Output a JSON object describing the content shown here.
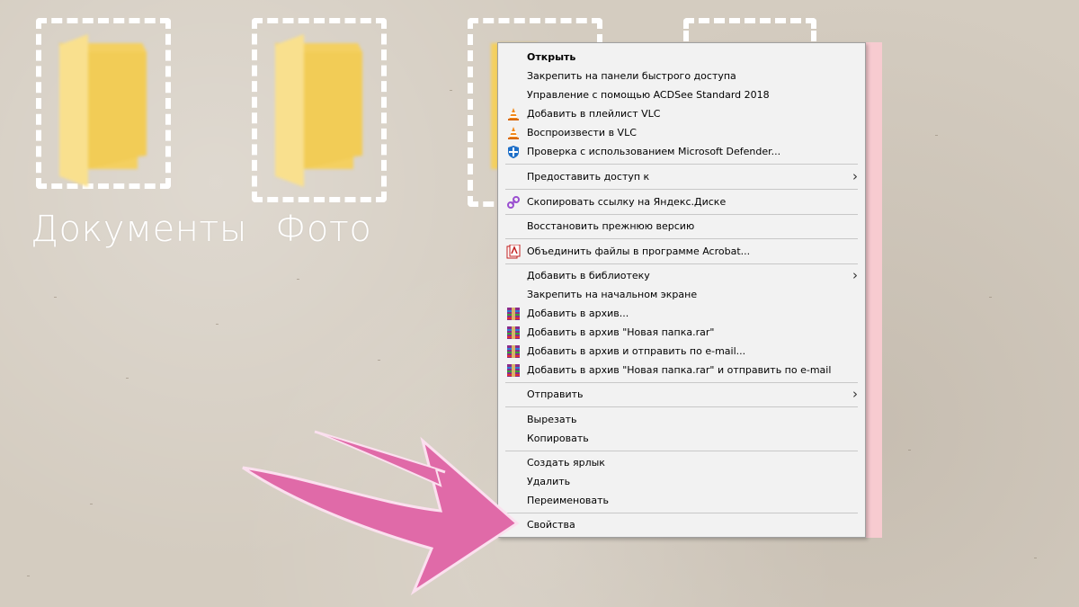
{
  "desktop": {
    "folders": [
      {
        "label": "Документы"
      },
      {
        "label": "Фото"
      }
    ]
  },
  "context_menu": {
    "items": [
      {
        "label": "Открыть",
        "bold": true,
        "icon": ""
      },
      {
        "label": "Закрепить на панели быстрого доступа",
        "icon": ""
      },
      {
        "label": "Управление с помощью ACDSee Standard 2018",
        "icon": ""
      },
      {
        "label": "Добавить в плейлист VLC",
        "icon": "vlc-icon"
      },
      {
        "label": "Воспроизвести в VLC",
        "icon": "vlc-icon"
      },
      {
        "label": "Проверка с использованием Microsoft Defender...",
        "icon": "defender-icon"
      },
      {
        "label": "Предоставить доступ к",
        "submenu": true
      },
      {
        "label": "Скопировать ссылку на Яндекс.Диске",
        "icon": "link-icon"
      },
      {
        "label": "Восстановить прежнюю версию"
      },
      {
        "label": "Объединить файлы в программе Acrobat...",
        "icon": "acrobat-icon"
      },
      {
        "label": "Добавить в библиотеку",
        "submenu": true
      },
      {
        "label": "Закрепить на начальном экране"
      },
      {
        "label": "Добавить в архив...",
        "icon": "winrar-icon"
      },
      {
        "label": "Добавить в архив \"Новая папка.rar\"",
        "icon": "winrar-icon"
      },
      {
        "label": "Добавить в архив и отправить по e-mail...",
        "icon": "winrar-icon"
      },
      {
        "label": "Добавить в архив \"Новая папка.rar\" и отправить по e-mail",
        "icon": "winrar-icon"
      },
      {
        "label": "Отправить",
        "submenu": true
      },
      {
        "label": "Вырезать"
      },
      {
        "label": "Копировать"
      },
      {
        "label": "Создать ярлык"
      },
      {
        "label": "Удалить"
      },
      {
        "label": "Переименовать"
      },
      {
        "label": "Свойства"
      }
    ]
  },
  "colors": {
    "folder": "#f5d36b",
    "arrow": "#e06aa8",
    "menu_bg": "#f2f2f2",
    "accent_strip": "#f7cbd0"
  }
}
